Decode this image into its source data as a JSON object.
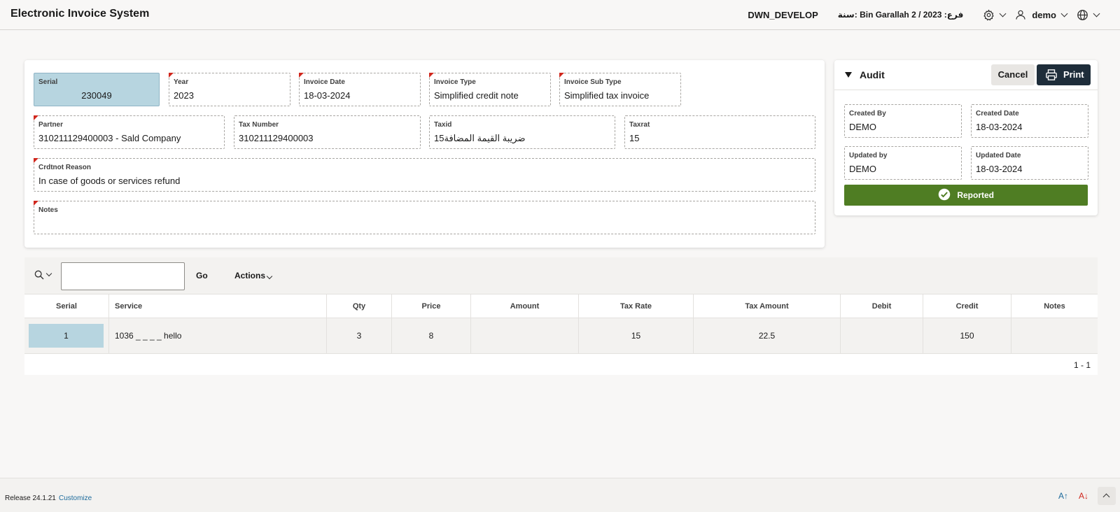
{
  "header": {
    "app_title": "Electronic Invoice System",
    "environment": "DWN_DEVELOP",
    "branch_info": "فرع: Bin Garallah 2 / 2023 :سنة",
    "user": "demo"
  },
  "form": {
    "serial": {
      "label": "Serial",
      "value": "230049"
    },
    "year": {
      "label": "Year",
      "value": "2023"
    },
    "invoice_date": {
      "label": "Invoice Date",
      "value": "18-03-2024"
    },
    "invoice_type": {
      "label": "Invoice Type",
      "value": "Simplified credit note"
    },
    "invoice_sub_type": {
      "label": "Invoice Sub Type",
      "value": "Simplified tax invoice"
    },
    "partner": {
      "label": "Partner",
      "value": "310211129400003 - Sald Company"
    },
    "tax_number": {
      "label": "Tax Number",
      "value": "310211129400003"
    },
    "taxid": {
      "label": "Taxid",
      "value": "ضريبة القيمة المضافة15"
    },
    "taxrat": {
      "label": "Taxrat",
      "value": "15"
    },
    "crdtnot_reason": {
      "label": "Crdtnot Reason",
      "value": "In case of goods or services refund"
    },
    "notes": {
      "label": "Notes",
      "value": ""
    }
  },
  "audit": {
    "title": "Audit",
    "cancel_label": "Cancel",
    "print_label": "Print",
    "created_by": {
      "label": "Created By",
      "value": "DEMO"
    },
    "created_date": {
      "label": "Created Date",
      "value": "18-03-2024"
    },
    "updated_by": {
      "label": "Updated by",
      "value": "DEMO"
    },
    "updated_date": {
      "label": "Updated Date",
      "value": "18-03-2024"
    },
    "status": "Reported",
    "status_color": "#4f7d23"
  },
  "grid": {
    "search_placeholder": "",
    "go_label": "Go",
    "actions_label": "Actions",
    "columns": [
      "Serial",
      "Service",
      "Qty",
      "Price",
      "Amount",
      "Tax Rate",
      "Tax Amount",
      "Debit",
      "Credit",
      "Notes"
    ],
    "rows": [
      {
        "serial": "1",
        "service": "1036 _ _ _ _ hello",
        "qty": "3",
        "price": "8",
        "amount": "",
        "tax_rate": "15",
        "tax_amount": "22.5",
        "debit": "",
        "credit": "150",
        "notes": ""
      }
    ],
    "pagination": "1 - 1"
  },
  "footer": {
    "release": "Release 24.1.21",
    "customize": "Customize"
  }
}
